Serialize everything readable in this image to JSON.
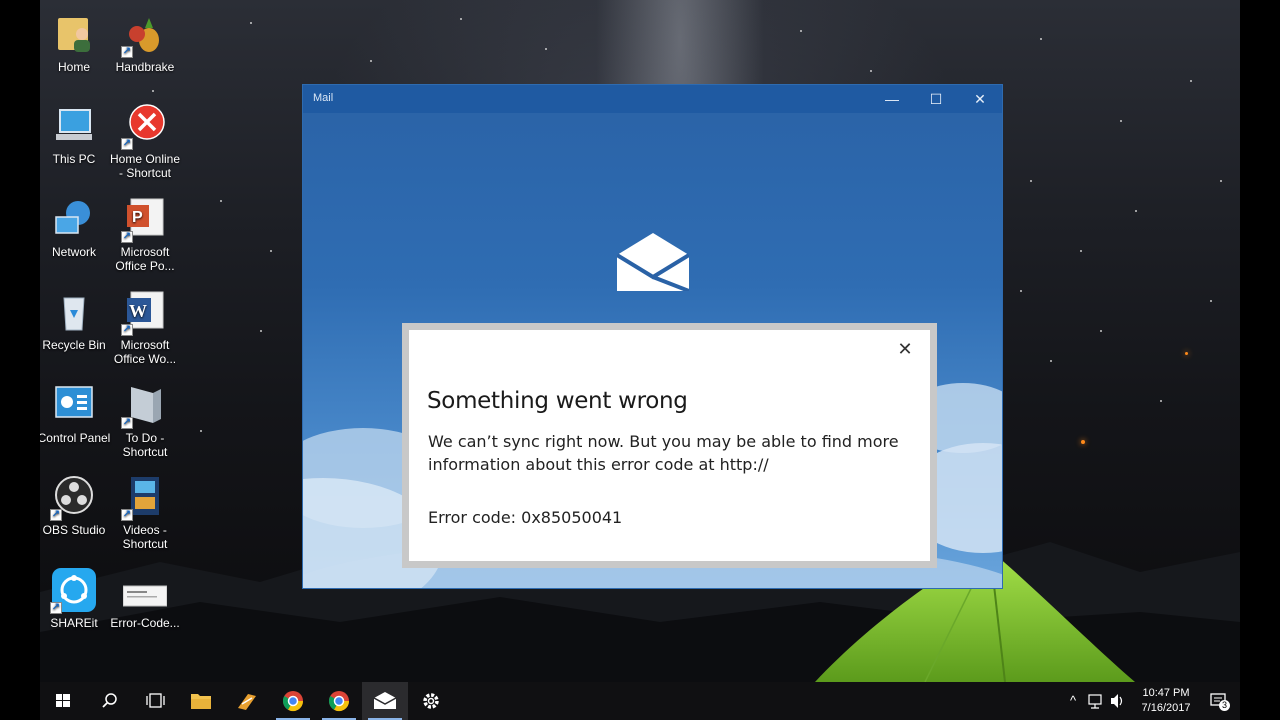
{
  "desktop": {
    "icons": [
      {
        "label": "Home",
        "icon": "user-folder-icon"
      },
      {
        "label": "Handbrake",
        "icon": "handbrake-icon"
      },
      {
        "label": "This PC",
        "icon": "computer-icon"
      },
      {
        "label": "Home Online - Shortcut",
        "icon": "error-x-icon"
      },
      {
        "label": "Network",
        "icon": "network-icon"
      },
      {
        "label": "Microsoft Office Po...",
        "icon": "powerpoint-icon"
      },
      {
        "label": "Recycle Bin",
        "icon": "recycle-bin-icon"
      },
      {
        "label": "Microsoft Office Wo...",
        "icon": "word-icon"
      },
      {
        "label": "Control Panel",
        "icon": "control-panel-icon"
      },
      {
        "label": "To Do - Shortcut",
        "icon": "todo-icon"
      },
      {
        "label": "OBS Studio",
        "icon": "obs-icon"
      },
      {
        "label": "Videos - Shortcut",
        "icon": "videos-icon"
      },
      {
        "label": "SHAREit",
        "icon": "shareit-icon"
      },
      {
        "label": "Error-Code...",
        "icon": "image-file-icon"
      }
    ]
  },
  "mail_window": {
    "title": "Mail",
    "minimize_glyph": "—",
    "maximize_glyph": "☐",
    "close_glyph": "✕"
  },
  "error_dialog": {
    "close_glyph": "✕",
    "heading": "Something went wrong",
    "message": "We can’t sync right now. But you may be able to find more information about this error code at http://",
    "error_code": "Error code: 0x85050041"
  },
  "taskbar": {
    "items": [
      "start-button",
      "search-button",
      "task-view-button",
      "file-explorer",
      "pinned-app",
      "chrome",
      "chrome",
      "mail",
      "settings"
    ]
  },
  "tray": {
    "time": "10:47 PM",
    "date": "7/16/2017",
    "notification_count": "3"
  },
  "colors": {
    "mail_blue": "#2a62a6",
    "taskbar": "#101012",
    "tent_green": "#8fd43a"
  }
}
